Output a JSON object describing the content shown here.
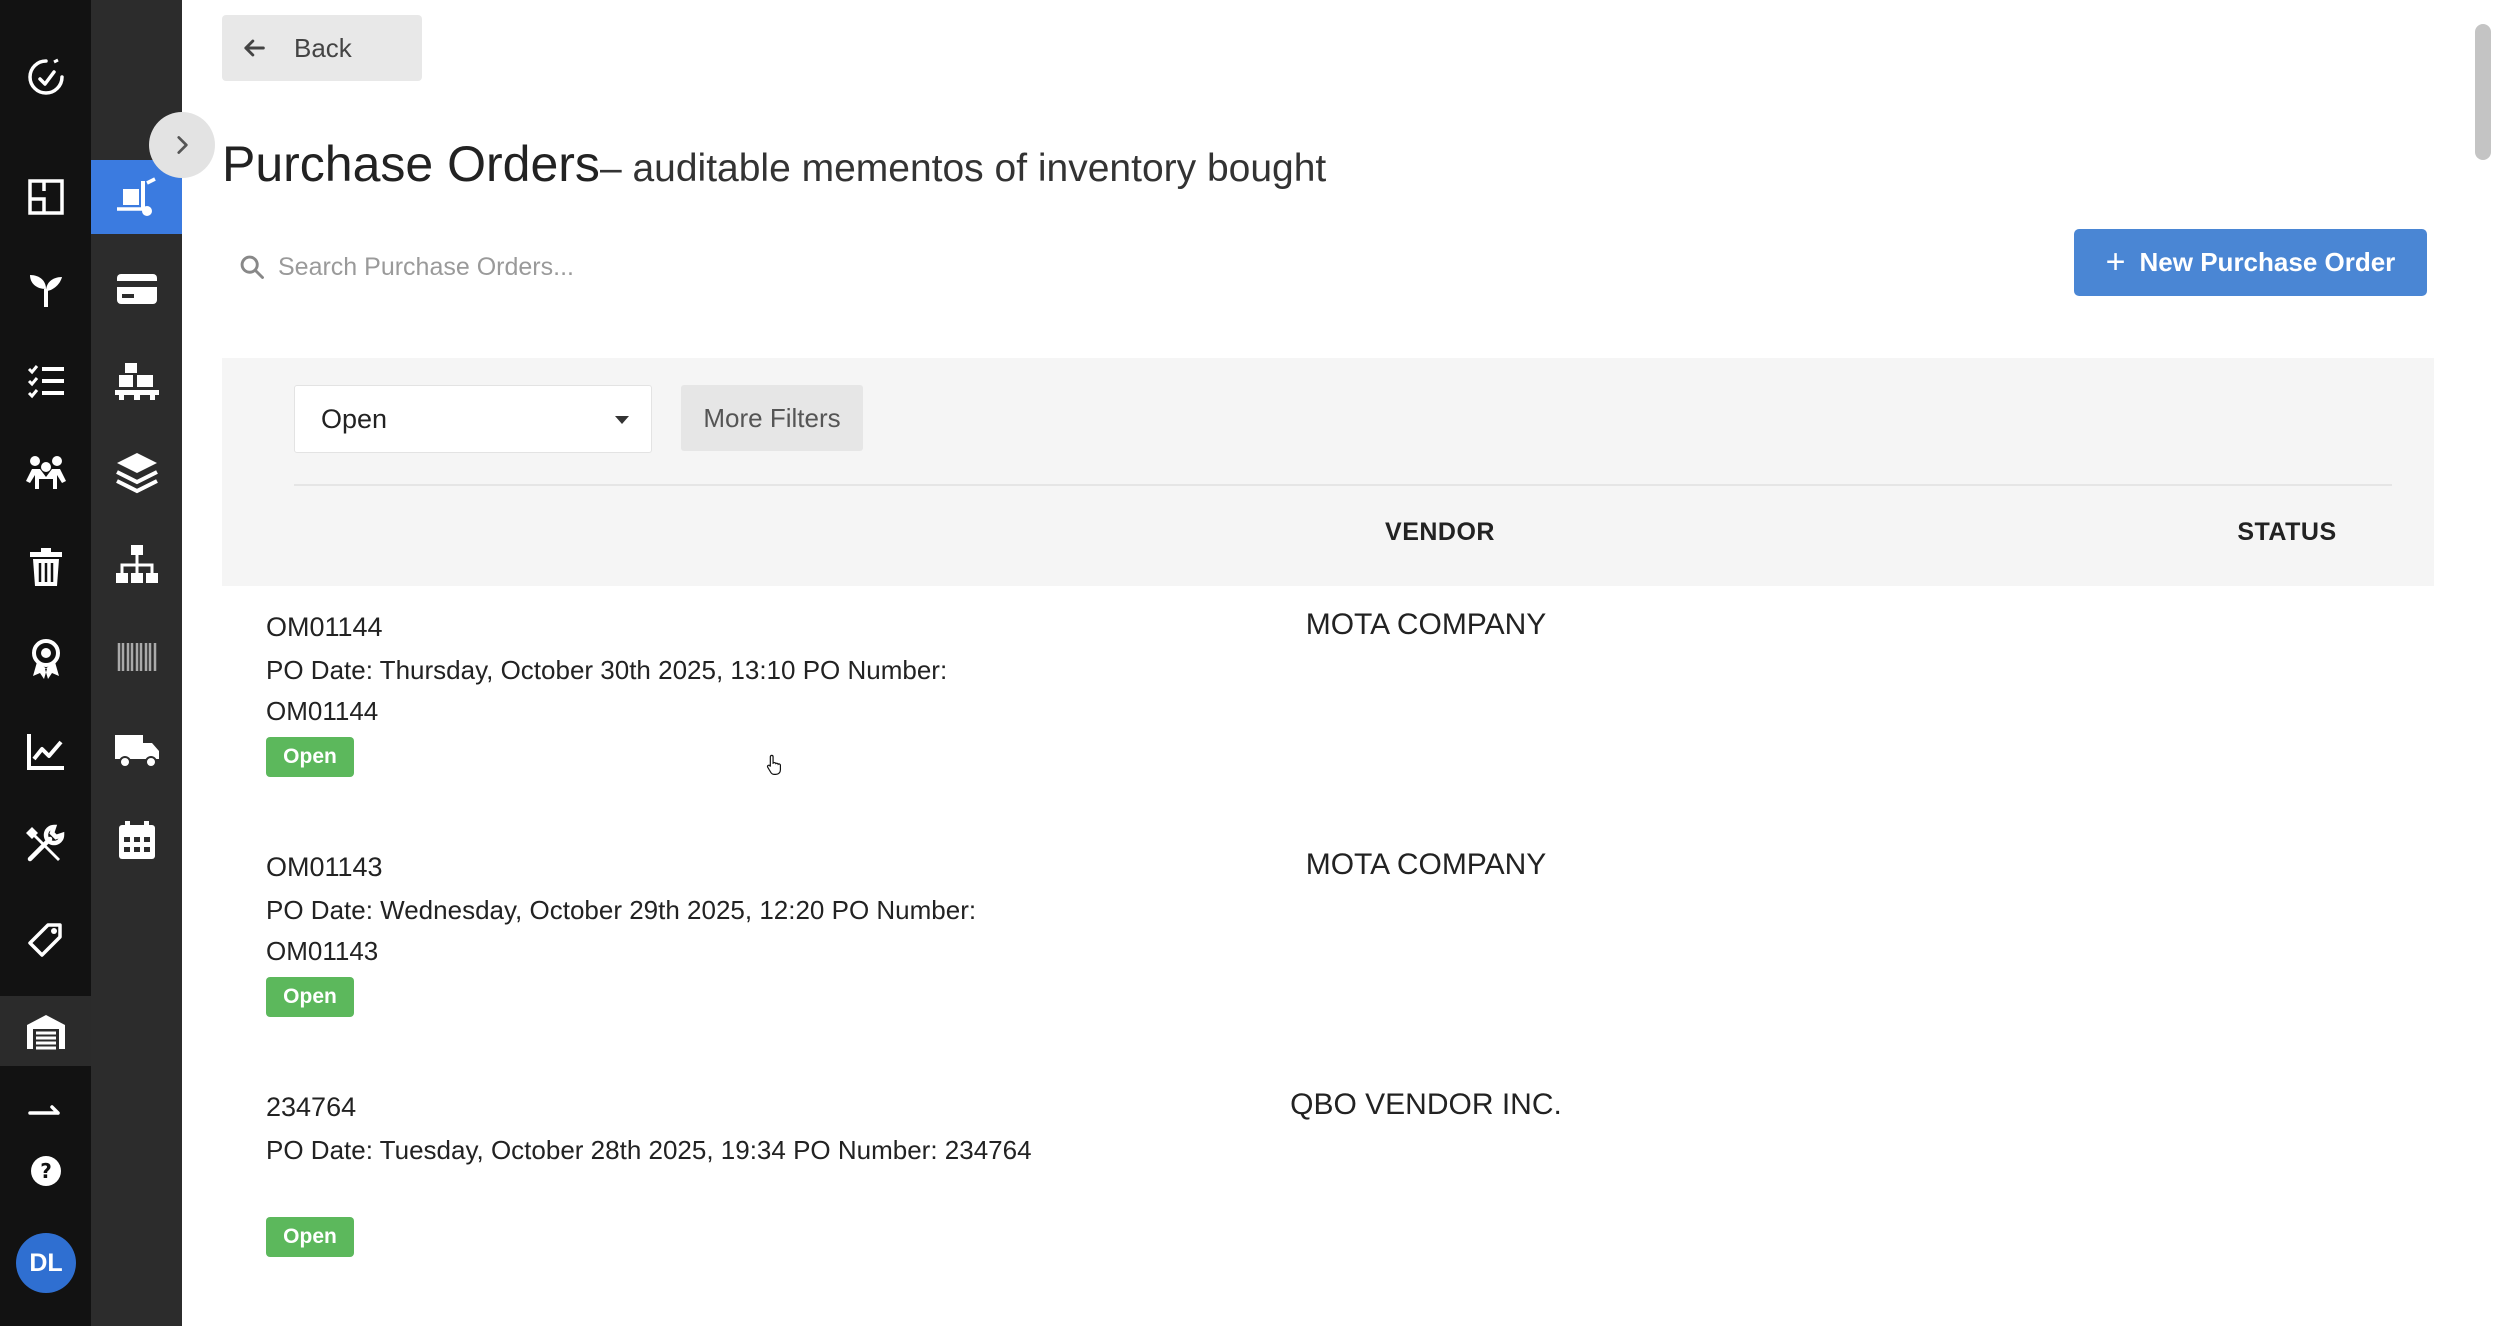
{
  "nav": {
    "back_label": "Back"
  },
  "page": {
    "title": "Purchase Orders",
    "subtitle": "– auditable mementos of inventory bought"
  },
  "search": {
    "placeholder": "Search Purchase Orders..."
  },
  "actions": {
    "new_po_label": "New Purchase Order"
  },
  "filters": {
    "status_selected": "Open",
    "more_filters_label": "More Filters"
  },
  "table": {
    "columns": [
      "VENDOR",
      "STATUS"
    ]
  },
  "orders": [
    {
      "id": "OM01144",
      "description": "PO Date: Thursday, October 30th 2025, 13:10 PO Number: OM01144",
      "status": "Open",
      "vendor": "MOTA COMPANY"
    },
    {
      "id": "OM01143",
      "description": "PO Date: Wednesday, October 29th 2025, 12:20 PO Number: OM01143",
      "status": "Open",
      "vendor": "MOTA COMPANY"
    },
    {
      "id": "234764",
      "description": "PO Date: Tuesday, October 28th 2025, 19:34 PO Number: 234764",
      "status": "Open",
      "vendor": "QBO VENDOR INC."
    }
  ],
  "user": {
    "initials": "DL"
  },
  "colors": {
    "primary": "#4a86d4",
    "status_open": "#5cb85c",
    "rail_dark": "#121212",
    "rail_secondary": "#2c2c2c",
    "rail_active": "#3b7be0"
  }
}
